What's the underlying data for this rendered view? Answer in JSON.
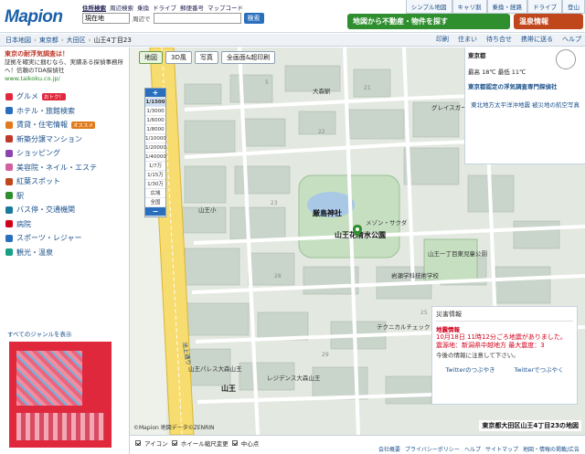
{
  "header": {
    "logo": "Mapion",
    "search_tabs": [
      "住所検索",
      "周辺検索",
      "乗換",
      "ドライブ",
      "郵便番号",
      "マップコード"
    ],
    "search_value": "現在地",
    "near_label": "周辺で",
    "search_button": "検索",
    "global_nav": [
      "シンプル地図",
      "キャリ割",
      "乗換・経路",
      "ドライブ",
      "登山"
    ],
    "banner1": "地図から不動産・物件を探す",
    "banner2": "温泉情報"
  },
  "breadcrumb": [
    "日本地図",
    "東京都",
    "大田区",
    "山王4丁目23"
  ],
  "map_tools": [
    "印刷",
    "住まい",
    "待ち合せ",
    "携帯に送る",
    "ヘルプ"
  ],
  "sidebar": {
    "ad_title": "東京の耐浮気調査は！",
    "ad_text": "証拠を確実に掴むなら、実績ある探偵事務所へ！信頼のTDA探偵社",
    "ad_url": "www.taikoku.co.jp/",
    "categories": [
      {
        "label": "グルメ",
        "badge": "おトク！",
        "color": "#e0283c"
      },
      {
        "label": "ホテル・旅館検索",
        "badge": "",
        "color": "#2a6fbd"
      },
      {
        "label": "賃貸・住宅情報",
        "badge": "オススメ",
        "color": "#e07a1c"
      },
      {
        "label": "新築分譲マンション",
        "badge": "",
        "color": "#c0392b"
      },
      {
        "label": "ショッピング",
        "badge": "",
        "color": "#8e44ad"
      },
      {
        "label": "美容院・ネイル・エステ",
        "badge": "",
        "color": "#d35fa0"
      },
      {
        "label": "紅葉スポット",
        "badge": "",
        "color": "#c0471c"
      },
      {
        "label": "駅",
        "badge": "",
        "color": "#2f8f2f"
      },
      {
        "label": "バス停・交通機関",
        "badge": "",
        "color": "#1a7a9a"
      },
      {
        "label": "病院",
        "badge": "",
        "color": "#d0001b"
      },
      {
        "label": "スポーツ・レジャー",
        "badge": "",
        "color": "#2a6fbd"
      },
      {
        "label": "観光・温泉",
        "badge": "",
        "color": "#16a085"
      }
    ],
    "all_genres": "すべてのジャンルを表示"
  },
  "map": {
    "toolbar": [
      "地図",
      "3D風",
      "写真",
      "全画面&超印刷"
    ],
    "zoom_levels": [
      "1/1500",
      "1/3000",
      "1/6000",
      "1/8000",
      "1/10000",
      "1/20000",
      "1/40000",
      "1/7万",
      "1/15万",
      "1/30万",
      "広域",
      "全国"
    ],
    "selected_zoom": "1/1500",
    "labels": {
      "park": "山王花清水公園",
      "shrine": "厳島神社",
      "park2": "山王一丁目東児童公園",
      "main_road": "池上通り",
      "area": "山王小",
      "gym": "レジデンス大森山王",
      "center": "山王",
      "mansion1": "メゾン・サクダ",
      "mansion2": "グレイスガーデン",
      "station": "大森駅",
      "school": "岩瀬学科技術学校",
      "palace": "山王パレス大森山王",
      "tec": "テクニカルチェック"
    },
    "address": "東京都大田区山王4丁目23の地図",
    "copyright": "©Mapion 地図データ©ZENRIN",
    "weather": {
      "title": "東京都",
      "temp": "最高 18℃ 最低 11℃",
      "note": "東京都認定の浮気調査専門探偵社",
      "link": "東北地方太平洋沖地震 被災地の航空写真"
    },
    "disaster": {
      "title": "災害情報",
      "head": "地震情報",
      "line1": "10月18日 11時12分ごろ地震がありました。",
      "line2": "震源地：新潟県中越地方 最大震度：3",
      "line3": "今後の情報に注意して下さい。",
      "tw1": "Twitterのつぶやき",
      "tw2": "Twitterでつぶやく"
    }
  },
  "footer": {
    "checks": [
      "アイコン",
      "ホイール縮尺変更",
      "中心点"
    ],
    "links": [
      "会社概要",
      "プライバシーポリシー",
      "ヘルプ",
      "サイトマップ",
      "地図・情報の掲載/広告"
    ]
  }
}
